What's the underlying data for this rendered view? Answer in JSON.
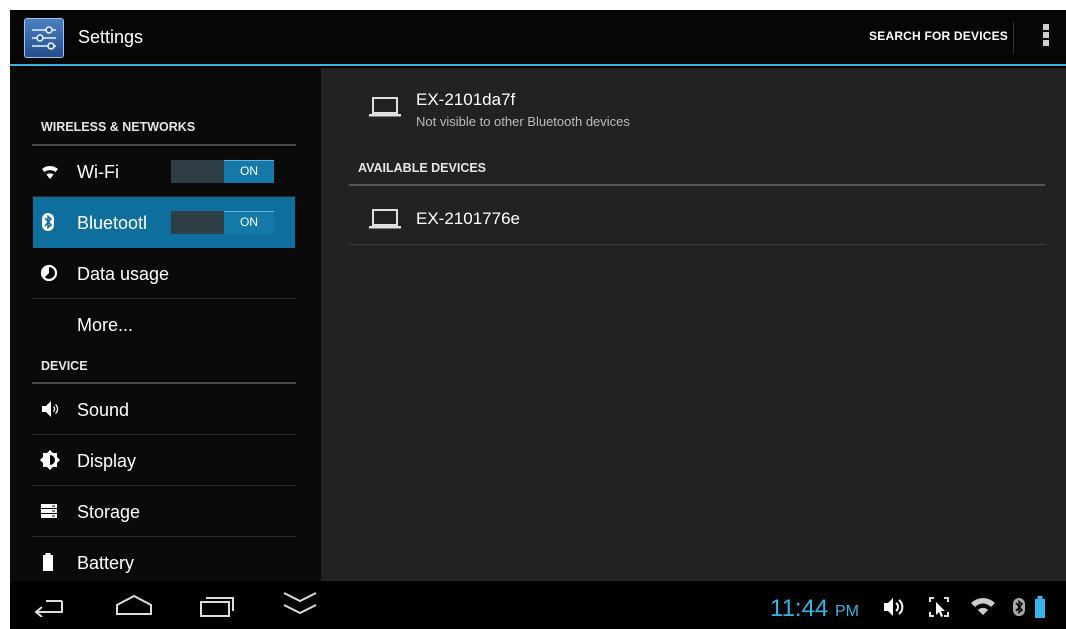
{
  "action_bar": {
    "title": "Settings",
    "search_button": "SEARCH FOR DEVICES",
    "overflow_icon": "overflow-menu-icon",
    "accent_color": "#33b5e5"
  },
  "sidebar": {
    "sections": [
      {
        "header": "WIRELESS & NETWORKS",
        "items": [
          {
            "label": "Wi-Fi",
            "icon": "wifi-icon",
            "toggle": "ON"
          },
          {
            "label": "Bluetootl",
            "icon": "bluetooth-icon",
            "toggle": "ON",
            "selected": true
          },
          {
            "label": "Data usage",
            "icon": "data-usage-icon"
          },
          {
            "label": "More...",
            "icon": ""
          }
        ]
      },
      {
        "header": "DEVICE",
        "items": [
          {
            "label": "Sound",
            "icon": "sound-icon"
          },
          {
            "label": "Display",
            "icon": "display-icon"
          },
          {
            "label": "Storage",
            "icon": "storage-icon"
          },
          {
            "label": "Battery",
            "icon": "battery-icon"
          }
        ]
      }
    ],
    "selected_color": "#0e6e9e"
  },
  "detail": {
    "this_device": {
      "name": "EX-2101da7f",
      "status": "Not visible to other Bluetooth devices",
      "icon": "laptop-icon"
    },
    "available_header": "AVAILABLE DEVICES",
    "available_devices": [
      {
        "name": "EX-2101776e",
        "icon": "laptop-icon"
      }
    ]
  },
  "nav_bar": {
    "buttons": [
      "back-icon",
      "home-icon",
      "recent-apps-icon",
      "hide-keyboard-icon"
    ],
    "time": "11:44",
    "ampm": "PM",
    "status_icons": [
      "volume-icon",
      "screenshot-icon",
      "wifi-icon",
      "bluetooth-icon",
      "battery-icon"
    ]
  }
}
